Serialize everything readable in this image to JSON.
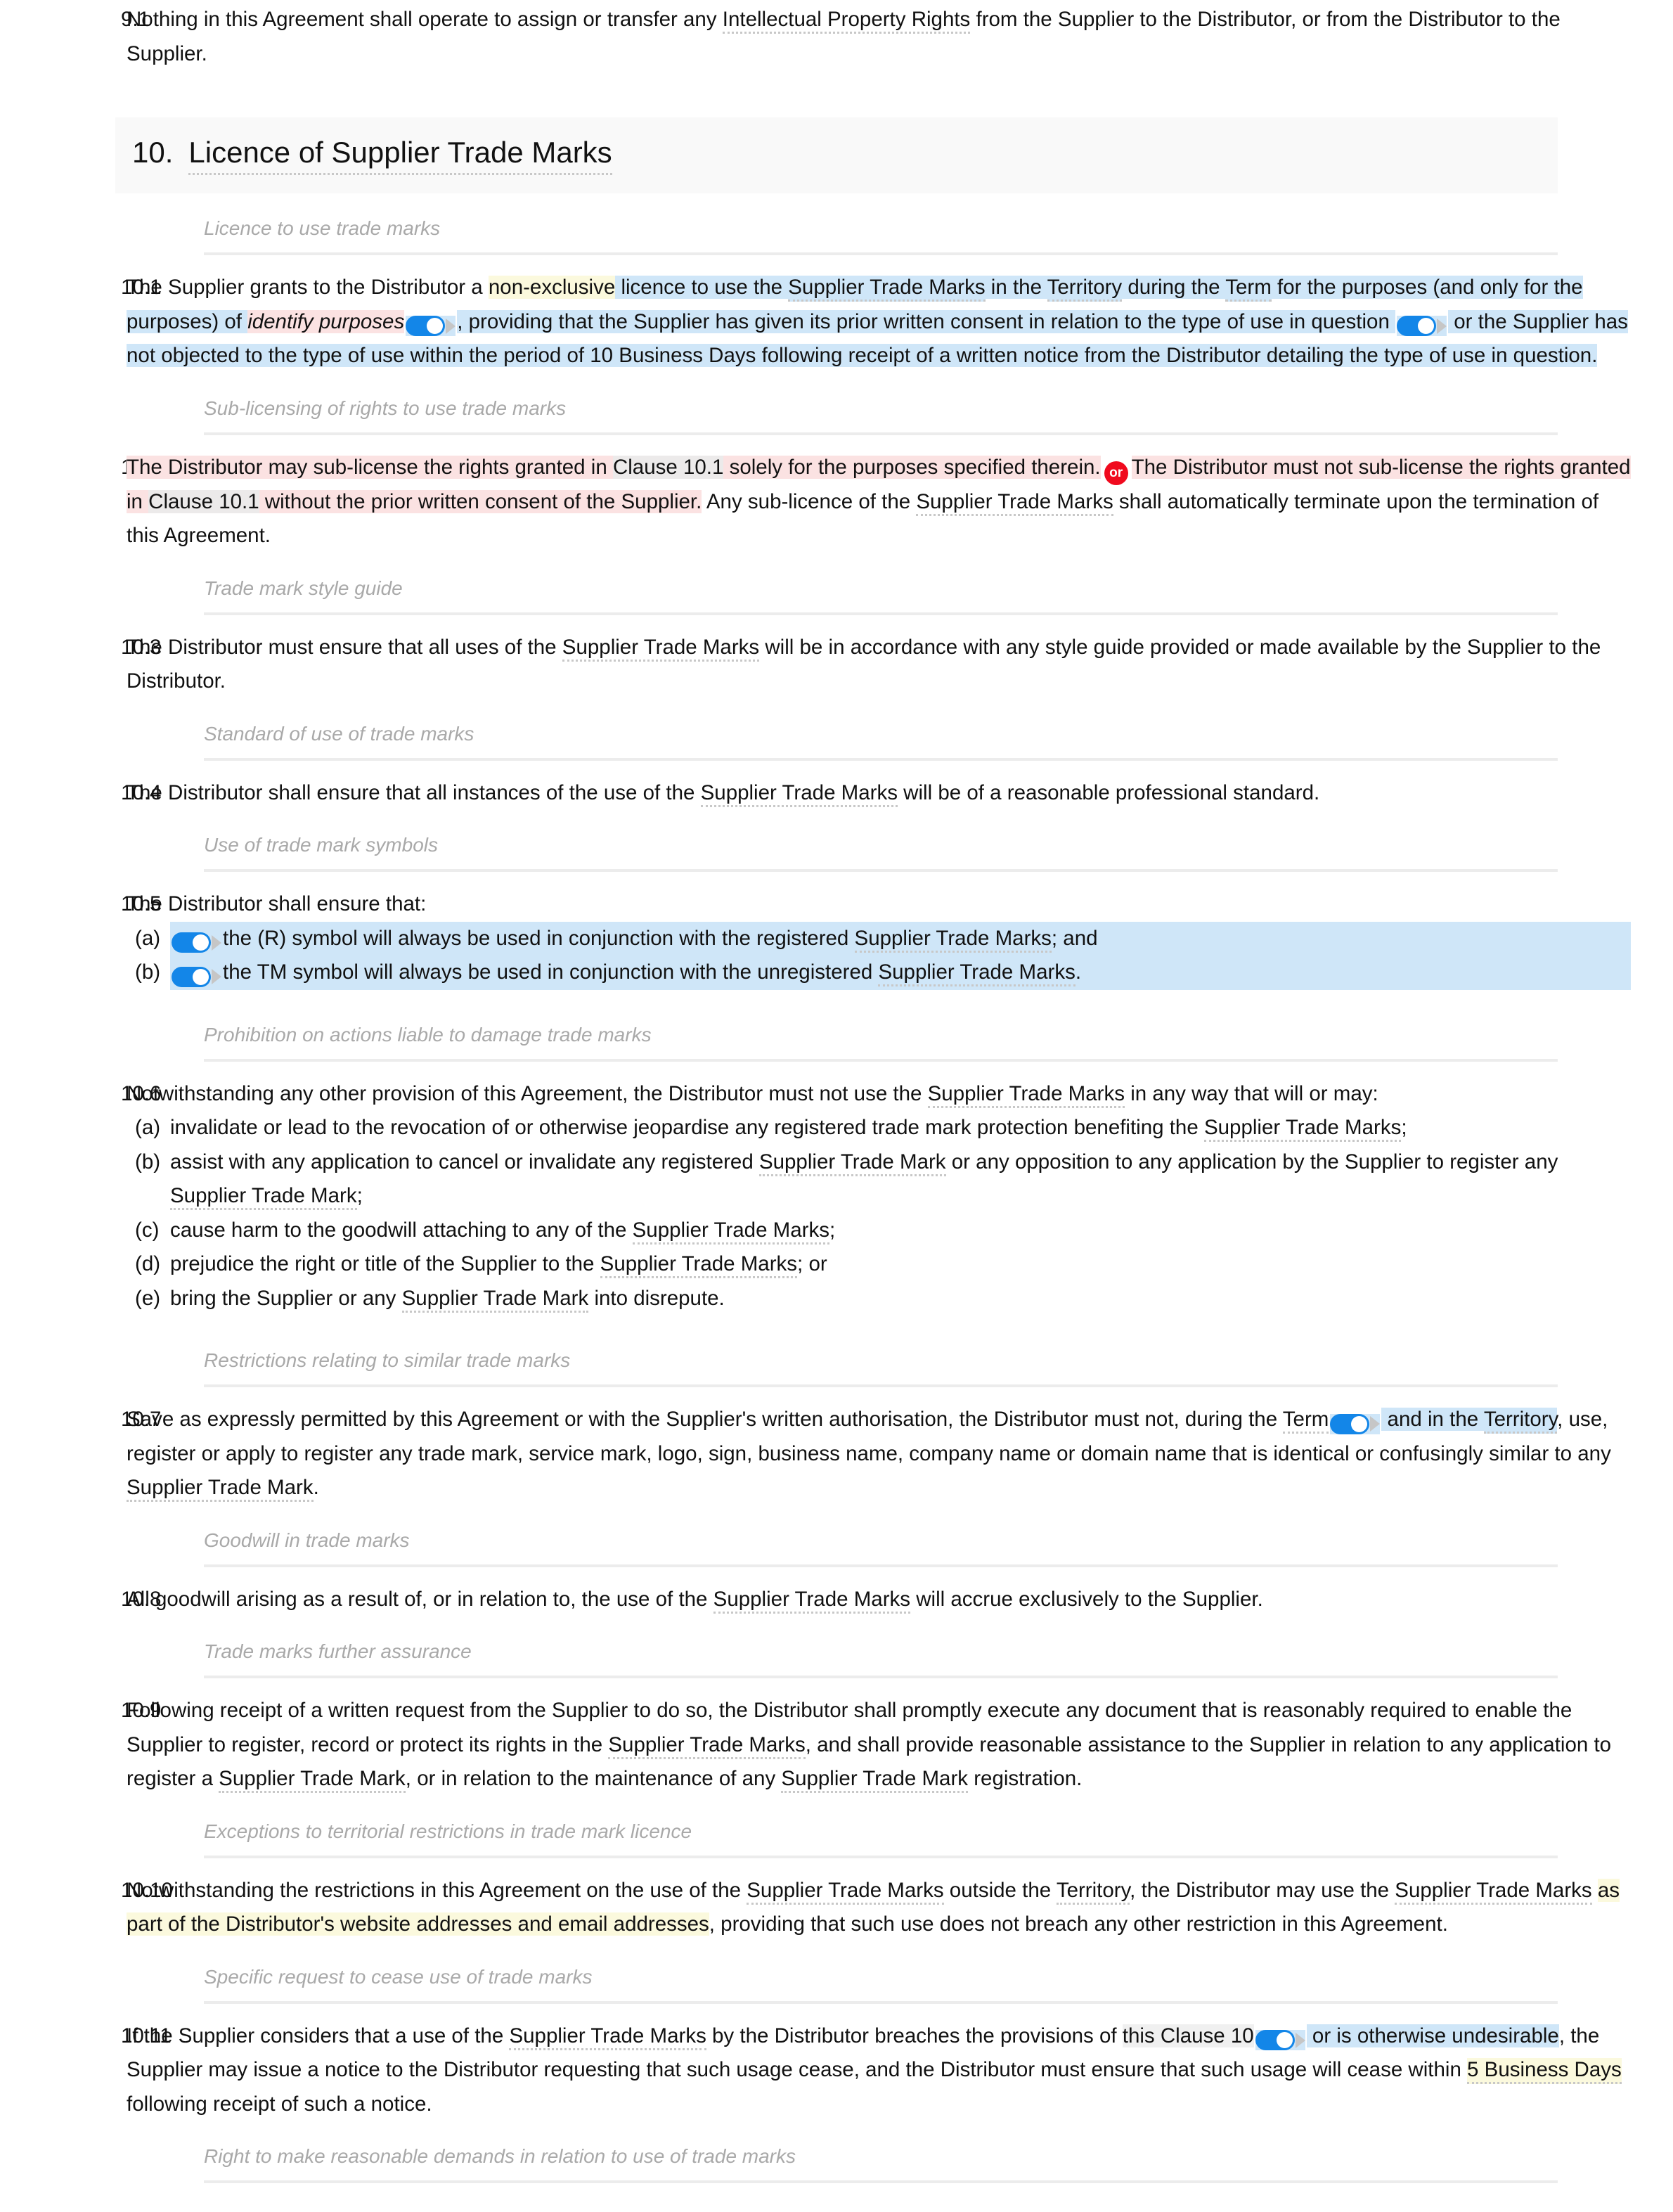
{
  "document": {
    "type": "contract",
    "accent_colors": {
      "highlight_blue": "#cfe6f8",
      "highlight_pink": "#fbe2e2",
      "highlight_yellow": "#fbf9dd",
      "highlight_grey": "#f0f0f0",
      "toggle_on": "#1386e8",
      "or_badge": "#f00a1e",
      "defined_term_underline": "#c8c8c8",
      "section_header_bg": "#f9f9f9",
      "subheading_text": "#a9a9a9"
    }
  },
  "clause_9_1": {
    "number": "9.1",
    "text_a": "Nothing in this Agreement shall operate to assign or transfer any ",
    "term_ipr": "Intellectual Property Rights",
    "text_b": " from the Supplier to the Distributor, or from the Distributor to the Supplier."
  },
  "section_10": {
    "number": "10.",
    "title": "Licence of Supplier Trade Marks"
  },
  "subheadings": {
    "licence_to_use": "Licence to use trade marks",
    "sub_licensing": "Sub-licensing of rights to use trade marks",
    "style_guide": "Trade mark style guide",
    "standard_of_use": "Standard of use of trade marks",
    "symbols": "Use of trade mark symbols",
    "prohibition": "Prohibition on actions liable to damage trade marks",
    "restrictions_similar": "Restrictions relating to similar trade marks",
    "goodwill": "Goodwill in trade marks",
    "further_assurance": "Trade marks further assurance",
    "territorial_exceptions": "Exceptions to territorial restrictions in trade mark licence",
    "cease_use": "Specific request to cease use of trade marks",
    "reasonable_demands": "Right to make reasonable demands in relation to use of trade marks"
  },
  "clause_10_1": {
    "number": "10.1",
    "t1": "The Supplier grants to the Distributor a ",
    "hl_non_exclusive": "non-exclusive",
    "t2": " licence to use the ",
    "term_stm": "Supplier Trade Marks",
    "t3": " in the ",
    "term_territory": "Territory",
    "t4": " during the ",
    "term_term": "Term",
    "t5": " for the purposes (and only for the purposes) of ",
    "placeholder_identify_purposes": "identify purposes",
    "toggle_1": "toggle-on",
    "t6": ", providing that the Supplier has given its prior written consent in relation to the type of use in question ",
    "toggle_2": "toggle-on",
    "t7": " or the Supplier has not objected to the type of use within the period of 10 Business Days following receipt of a written notice from the Distributor detailing the type of use in question."
  },
  "clause_10_2": {
    "number": "10.2",
    "t1": "The Distributor may sub-license the rights granted in ",
    "xref_1": "Clause 10.1",
    "t2": " solely for the purposes specified therein.",
    "or_label": "or",
    "t3": "The Distributor must not sub-license the rights granted in ",
    "xref_2": "Clause 10.1",
    "t4": " without the prior written consent of the Supplier.",
    "t5": " Any sub-licence of the ",
    "term_stm": "Supplier Trade Marks",
    "t6": " shall automatically terminate upon the termination of this Agreement."
  },
  "clause_10_3": {
    "number": "10.3",
    "t1": "The Distributor must ensure that all uses of the ",
    "term_stm": "Supplier Trade Marks",
    "t2": " will be in accordance with any style guide provided or made available by the Supplier to the Distributor."
  },
  "clause_10_4": {
    "number": "10.4",
    "t1": "The Distributor shall ensure that all instances of the use of the ",
    "term_stm": "Supplier Trade Marks",
    "t2": " will be of a reasonable professional standard."
  },
  "clause_10_5": {
    "number": "10.5",
    "lead": "The Distributor shall ensure that:",
    "items": [
      {
        "letter": "(a)",
        "toggle": "toggle-on",
        "t1": "the (R) symbol will always be used in conjunction with the registered ",
        "term": "Supplier Trade Marks",
        "t2": "; and"
      },
      {
        "letter": "(b)",
        "toggle": "toggle-on",
        "t1": "the TM symbol will always be used in conjunction with the unregistered ",
        "term": "Supplier Trade Marks",
        "t2": "."
      }
    ]
  },
  "clause_10_6": {
    "number": "10.6",
    "lead_t1": "Notwithstanding any other provision of this Agreement, the Distributor must not use the ",
    "lead_term": "Supplier Trade Marks",
    "lead_t2": " in any way that will or may:",
    "items": [
      {
        "letter": "(a)",
        "t1": "invalidate or lead to the revocation of or otherwise jeopardise any registered trade mark protection benefiting the ",
        "term": "Supplier Trade Marks",
        "t2": ";"
      },
      {
        "letter": "(b)",
        "t1": "assist with any application to cancel or invalidate any registered ",
        "term": "Supplier Trade Mark",
        "t2": " or any opposition to any application by the Supplier to register any ",
        "term2": "Supplier Trade Mark",
        "t3": ";"
      },
      {
        "letter": "(c)",
        "t1": "cause harm to the goodwill attaching to any of the ",
        "term": "Supplier Trade Marks",
        "t2": ";"
      },
      {
        "letter": "(d)",
        "t1": "prejudice the right or title of the Supplier to the ",
        "term": "Supplier Trade Marks",
        "t2": "; or"
      },
      {
        "letter": "(e)",
        "t1": "bring the Supplier or any ",
        "term": "Supplier Trade Mark",
        "t2": " into disrepute."
      }
    ]
  },
  "clause_10_7": {
    "number": "10.7",
    "t1": "Save as expressly permitted by this Agreement or with the Supplier's written authorisation, the Distributor must not, during the ",
    "term_term": "Term",
    "toggle": "toggle-on",
    "t2": " and in the ",
    "term_territory": "Territory",
    "t3": ", use, register or apply to register any trade mark, service mark, logo, sign, business name, company name or domain name that is identical or confusingly similar to any ",
    "term_stm": "Supplier Trade Mark",
    "t4": "."
  },
  "clause_10_8": {
    "number": "10.8",
    "t1": "All goodwill arising as a result of, or in relation to, the use of the ",
    "term_stm": "Supplier Trade Marks",
    "t2": " will accrue exclusively to the Supplier."
  },
  "clause_10_9": {
    "number": "10.9",
    "t1": "Following receipt of a written request from the Supplier to do so, the Distributor shall promptly execute any document that is reasonably required to enable the Supplier to register, record or protect its rights in the ",
    "term_1": "Supplier Trade Marks",
    "t2": ", and shall provide reasonable assistance to the Supplier in relation to any application to register a ",
    "term_2": "Supplier Trade Mark",
    "t3": ", or in relation to the maintenance of any ",
    "term_3": "Supplier Trade Mark",
    "t4": " registration."
  },
  "clause_10_10": {
    "number": "10.10",
    "t1": "Notwithstanding the restrictions in this Agreement on the use of the ",
    "term_stm": "Supplier Trade Marks",
    "t2": " outside the ",
    "term_territory": "Territory",
    "t3": ", the Distributor may use the ",
    "term_stm2": "Supplier Trade Marks",
    "t4": " ",
    "hl_yellow": "as part of the Distributor's website addresses and email addresses",
    "t5": ", providing that such use does not breach any other restriction in this Agreement."
  },
  "clause_10_11": {
    "number": "10.11",
    "t1": "If the Supplier considers that a use of the ",
    "term_stm": "Supplier Trade Marks",
    "t2": " by the Distributor breaches the provisions of ",
    "xref": "this Clause 10",
    "toggle": "toggle-on",
    "t3": " or is otherwise undesirable",
    "t4": ", the Supplier may issue a notice to the Distributor requesting that such usage cease, and the Distributor must ensure that such usage will cease within ",
    "hl_days": "5 Business Days",
    "t5": " following receipt of such a notice."
  }
}
